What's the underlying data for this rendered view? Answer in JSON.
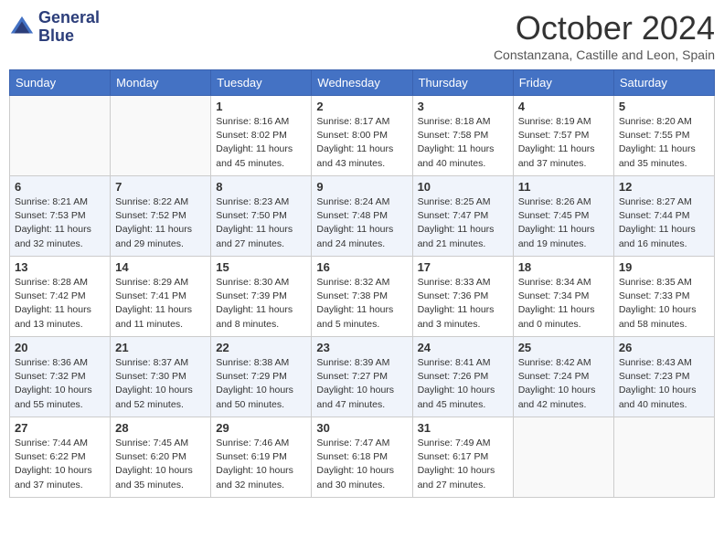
{
  "logo": {
    "line1": "General",
    "line2": "Blue"
  },
  "title": "October 2024",
  "subtitle": "Constanzana, Castille and Leon, Spain",
  "days_of_week": [
    "Sunday",
    "Monday",
    "Tuesday",
    "Wednesday",
    "Thursday",
    "Friday",
    "Saturday"
  ],
  "weeks": [
    [
      {
        "day": "",
        "info": ""
      },
      {
        "day": "",
        "info": ""
      },
      {
        "day": "1",
        "info": "Sunrise: 8:16 AM\nSunset: 8:02 PM\nDaylight: 11 hours and 45 minutes."
      },
      {
        "day": "2",
        "info": "Sunrise: 8:17 AM\nSunset: 8:00 PM\nDaylight: 11 hours and 43 minutes."
      },
      {
        "day": "3",
        "info": "Sunrise: 8:18 AM\nSunset: 7:58 PM\nDaylight: 11 hours and 40 minutes."
      },
      {
        "day": "4",
        "info": "Sunrise: 8:19 AM\nSunset: 7:57 PM\nDaylight: 11 hours and 37 minutes."
      },
      {
        "day": "5",
        "info": "Sunrise: 8:20 AM\nSunset: 7:55 PM\nDaylight: 11 hours and 35 minutes."
      }
    ],
    [
      {
        "day": "6",
        "info": "Sunrise: 8:21 AM\nSunset: 7:53 PM\nDaylight: 11 hours and 32 minutes."
      },
      {
        "day": "7",
        "info": "Sunrise: 8:22 AM\nSunset: 7:52 PM\nDaylight: 11 hours and 29 minutes."
      },
      {
        "day": "8",
        "info": "Sunrise: 8:23 AM\nSunset: 7:50 PM\nDaylight: 11 hours and 27 minutes."
      },
      {
        "day": "9",
        "info": "Sunrise: 8:24 AM\nSunset: 7:48 PM\nDaylight: 11 hours and 24 minutes."
      },
      {
        "day": "10",
        "info": "Sunrise: 8:25 AM\nSunset: 7:47 PM\nDaylight: 11 hours and 21 minutes."
      },
      {
        "day": "11",
        "info": "Sunrise: 8:26 AM\nSunset: 7:45 PM\nDaylight: 11 hours and 19 minutes."
      },
      {
        "day": "12",
        "info": "Sunrise: 8:27 AM\nSunset: 7:44 PM\nDaylight: 11 hours and 16 minutes."
      }
    ],
    [
      {
        "day": "13",
        "info": "Sunrise: 8:28 AM\nSunset: 7:42 PM\nDaylight: 11 hours and 13 minutes."
      },
      {
        "day": "14",
        "info": "Sunrise: 8:29 AM\nSunset: 7:41 PM\nDaylight: 11 hours and 11 minutes."
      },
      {
        "day": "15",
        "info": "Sunrise: 8:30 AM\nSunset: 7:39 PM\nDaylight: 11 hours and 8 minutes."
      },
      {
        "day": "16",
        "info": "Sunrise: 8:32 AM\nSunset: 7:38 PM\nDaylight: 11 hours and 5 minutes."
      },
      {
        "day": "17",
        "info": "Sunrise: 8:33 AM\nSunset: 7:36 PM\nDaylight: 11 hours and 3 minutes."
      },
      {
        "day": "18",
        "info": "Sunrise: 8:34 AM\nSunset: 7:34 PM\nDaylight: 11 hours and 0 minutes."
      },
      {
        "day": "19",
        "info": "Sunrise: 8:35 AM\nSunset: 7:33 PM\nDaylight: 10 hours and 58 minutes."
      }
    ],
    [
      {
        "day": "20",
        "info": "Sunrise: 8:36 AM\nSunset: 7:32 PM\nDaylight: 10 hours and 55 minutes."
      },
      {
        "day": "21",
        "info": "Sunrise: 8:37 AM\nSunset: 7:30 PM\nDaylight: 10 hours and 52 minutes."
      },
      {
        "day": "22",
        "info": "Sunrise: 8:38 AM\nSunset: 7:29 PM\nDaylight: 10 hours and 50 minutes."
      },
      {
        "day": "23",
        "info": "Sunrise: 8:39 AM\nSunset: 7:27 PM\nDaylight: 10 hours and 47 minutes."
      },
      {
        "day": "24",
        "info": "Sunrise: 8:41 AM\nSunset: 7:26 PM\nDaylight: 10 hours and 45 minutes."
      },
      {
        "day": "25",
        "info": "Sunrise: 8:42 AM\nSunset: 7:24 PM\nDaylight: 10 hours and 42 minutes."
      },
      {
        "day": "26",
        "info": "Sunrise: 8:43 AM\nSunset: 7:23 PM\nDaylight: 10 hours and 40 minutes."
      }
    ],
    [
      {
        "day": "27",
        "info": "Sunrise: 7:44 AM\nSunset: 6:22 PM\nDaylight: 10 hours and 37 minutes."
      },
      {
        "day": "28",
        "info": "Sunrise: 7:45 AM\nSunset: 6:20 PM\nDaylight: 10 hours and 35 minutes."
      },
      {
        "day": "29",
        "info": "Sunrise: 7:46 AM\nSunset: 6:19 PM\nDaylight: 10 hours and 32 minutes."
      },
      {
        "day": "30",
        "info": "Sunrise: 7:47 AM\nSunset: 6:18 PM\nDaylight: 10 hours and 30 minutes."
      },
      {
        "day": "31",
        "info": "Sunrise: 7:49 AM\nSunset: 6:17 PM\nDaylight: 10 hours and 27 minutes."
      },
      {
        "day": "",
        "info": ""
      },
      {
        "day": "",
        "info": ""
      }
    ]
  ]
}
